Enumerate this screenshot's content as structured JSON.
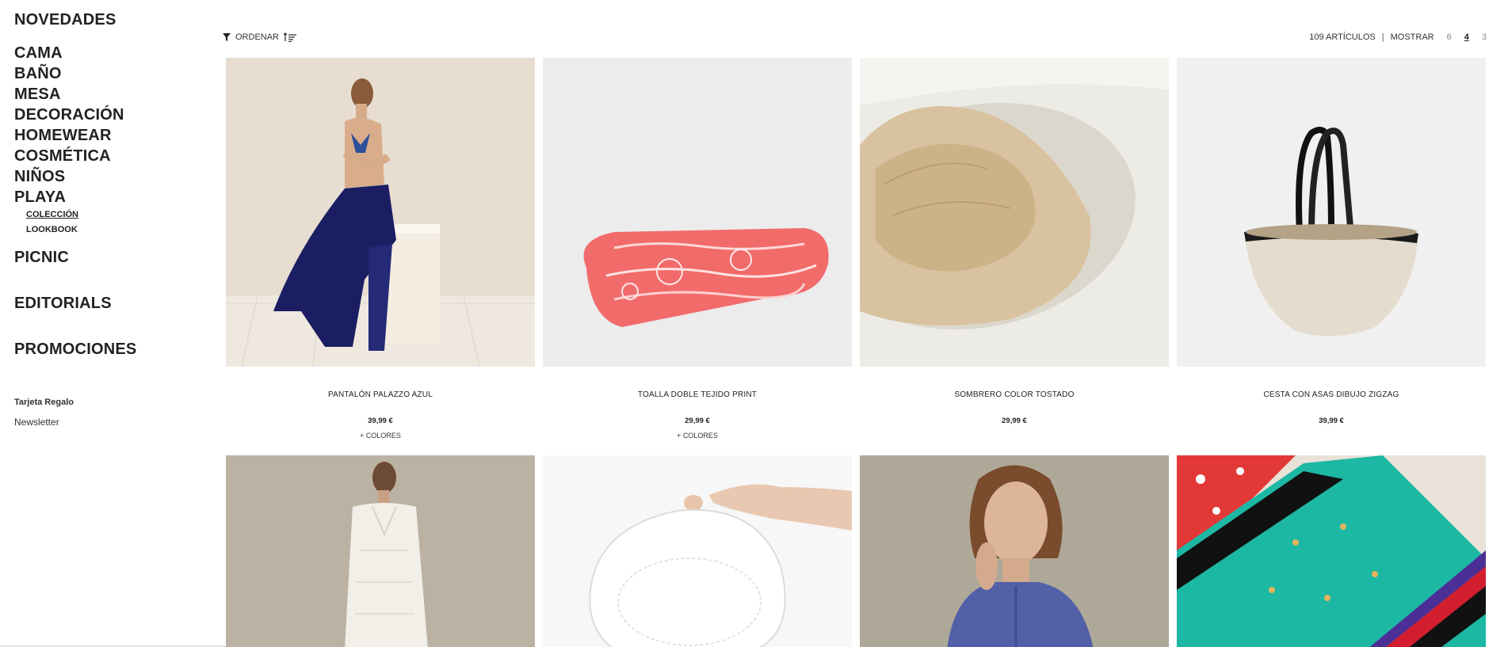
{
  "sidebar": {
    "top": "NOVEDADES",
    "categories": [
      "CAMA",
      "BAÑO",
      "MESA",
      "DECORACIÓN",
      "HOMEWEAR",
      "COSMÉTICA",
      "NIÑOS",
      "PLAYA"
    ],
    "playa_sub": [
      "COLECCIÓN",
      "LOOKBOOK"
    ],
    "picnic": "PICNIC",
    "editorials": "EDITORIALS",
    "promociones": "PROMOCIONES",
    "gift_card": "Tarjeta Regalo",
    "newsletter": "Newsletter"
  },
  "toolbar": {
    "sort_label": "ORDENAR",
    "count": "109 ARTÍCULOS",
    "separator": "|",
    "show_label": "MOSTRAR",
    "grid_options": [
      "6",
      "4",
      "3"
    ],
    "grid_selected": "4"
  },
  "products": [
    {
      "name": "PANTALÓN PALAZZO AZUL",
      "price": "39,99 €",
      "colors": "+ COLORES"
    },
    {
      "name": "TOALLA DOBLE TEJIDO PRINT",
      "price": "29,99 €",
      "colors": "+ COLORES"
    },
    {
      "name": "SOMBRERO COLOR TOSTADO",
      "price": "29,99 €",
      "colors": ""
    },
    {
      "name": "CESTA CON ASAS DIBUJO ZIGZAG",
      "price": "39,99 €",
      "colors": ""
    }
  ],
  "icons": {
    "filter": "funnel-icon",
    "sort": "sort-lines-icon"
  }
}
